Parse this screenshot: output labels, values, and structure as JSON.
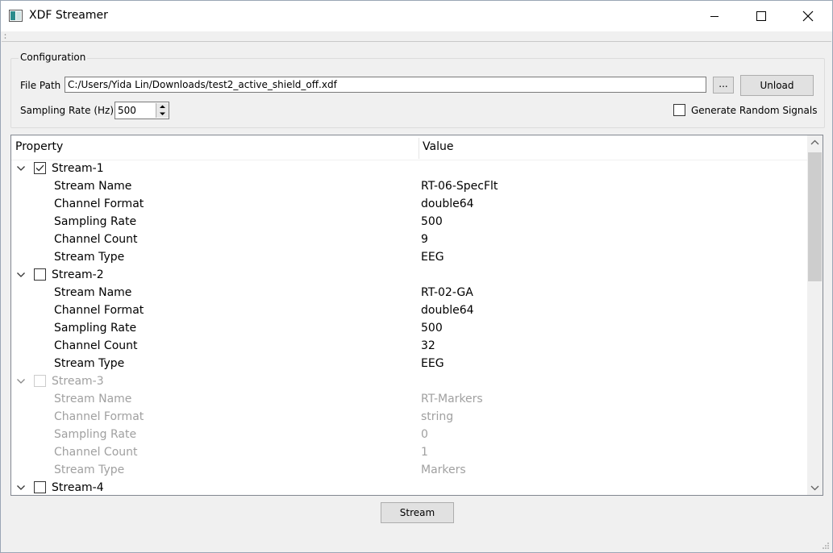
{
  "window": {
    "title": "XDF Streamer"
  },
  "config": {
    "group_title": "Configuration",
    "file_path_label": "File Path",
    "file_path_value": "C:/Users/Yida Lin/Downloads/test2_active_shield_off.xdf",
    "browse_label": "...",
    "unload_label": "Unload",
    "sampling_rate_label": "Sampling Rate (Hz)",
    "sampling_rate_value": "500",
    "random_signals_label": "Generate Random Signals",
    "random_signals_checked": false
  },
  "tree": {
    "columns": [
      "Property",
      "Value"
    ],
    "streams": [
      {
        "name": "Stream-1",
        "checked": true,
        "enabled": true,
        "props": [
          {
            "key": "Stream Name",
            "value": "RT-06-SpecFlt"
          },
          {
            "key": "Channel Format",
            "value": "double64"
          },
          {
            "key": "Sampling Rate",
            "value": "500"
          },
          {
            "key": "Channel Count",
            "value": "9"
          },
          {
            "key": "Stream Type",
            "value": "EEG"
          }
        ]
      },
      {
        "name": "Stream-2",
        "checked": false,
        "enabled": true,
        "props": [
          {
            "key": "Stream Name",
            "value": "RT-02-GA"
          },
          {
            "key": "Channel Format",
            "value": "double64"
          },
          {
            "key": "Sampling Rate",
            "value": "500"
          },
          {
            "key": "Channel Count",
            "value": "32"
          },
          {
            "key": "Stream Type",
            "value": "EEG"
          }
        ]
      },
      {
        "name": "Stream-3",
        "checked": false,
        "enabled": false,
        "props": [
          {
            "key": "Stream Name",
            "value": "RT-Markers"
          },
          {
            "key": "Channel Format",
            "value": "string"
          },
          {
            "key": "Sampling Rate",
            "value": "0"
          },
          {
            "key": "Channel Count",
            "value": "1"
          },
          {
            "key": "Stream Type",
            "value": "Markers"
          }
        ]
      },
      {
        "name": "Stream-4",
        "checked": false,
        "enabled": true,
        "props": []
      }
    ]
  },
  "footer": {
    "stream_button_label": "Stream"
  }
}
